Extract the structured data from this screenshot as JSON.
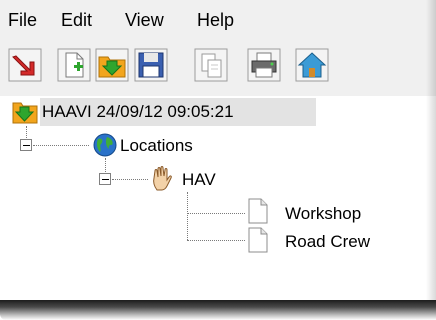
{
  "menu": {
    "file": "File",
    "edit": "Edit",
    "view": "View",
    "help": "Help"
  },
  "toolbar": {
    "buttons": [
      {
        "icon": "red-down-arrow-icon"
      },
      {
        "icon": "new-document-icon"
      },
      {
        "icon": "import-folder-icon"
      },
      {
        "icon": "save-disk-icon"
      },
      {
        "icon": "copy-document-icon"
      },
      {
        "icon": "printer-icon"
      },
      {
        "icon": "home-icon"
      }
    ]
  },
  "tree": {
    "root": {
      "label": "HAAVI 24/09/12 09:05:21",
      "icon": "folder-import-icon"
    },
    "locations": {
      "label": "Locations",
      "icon": "globe-icon"
    },
    "hav": {
      "label": "HAV",
      "icon": "hand-icon"
    },
    "children": [
      {
        "label": "Workshop",
        "icon": "document-icon"
      },
      {
        "label": "Road Crew",
        "icon": "document-icon"
      }
    ]
  },
  "colors": {
    "accent_red": "#d42a2a",
    "folder_orange": "#f2a51d",
    "arrow_green": "#2ea52e",
    "disk_blue": "#3a5fb0"
  }
}
